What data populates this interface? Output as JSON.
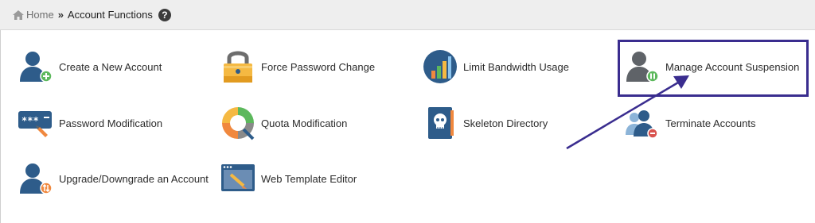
{
  "breadcrumb": {
    "home_label": "Home",
    "separator": "»",
    "current_label": "Account Functions",
    "help_glyph": "?"
  },
  "functions": [
    {
      "label": "Create a New Account",
      "icon": "user-add-icon"
    },
    {
      "label": "Force Password Change",
      "icon": "padlock-icon"
    },
    {
      "label": "Limit Bandwidth Usage",
      "icon": "bandwidth-chart-icon"
    },
    {
      "label": "Manage Account Suspension",
      "icon": "user-pause-icon"
    },
    {
      "label": "Password Modification",
      "icon": "password-field-icon"
    },
    {
      "label": "Quota Modification",
      "icon": "quota-donut-icon"
    },
    {
      "label": "Skeleton Directory",
      "icon": "skull-book-icon"
    },
    {
      "label": "Terminate Accounts",
      "icon": "users-remove-icon"
    },
    {
      "label": "Upgrade/Downgrade an Account",
      "icon": "user-upgrade-icon"
    },
    {
      "label": "Web Template Editor",
      "icon": "template-editor-icon"
    }
  ],
  "colors": {
    "highlight": "#3a2d8f",
    "icon_blue": "#2e5c8a",
    "icon_gray": "#5f6368",
    "accent_green": "#5cb85c",
    "accent_orange": "#f0883e",
    "accent_red": "#d9534f"
  }
}
